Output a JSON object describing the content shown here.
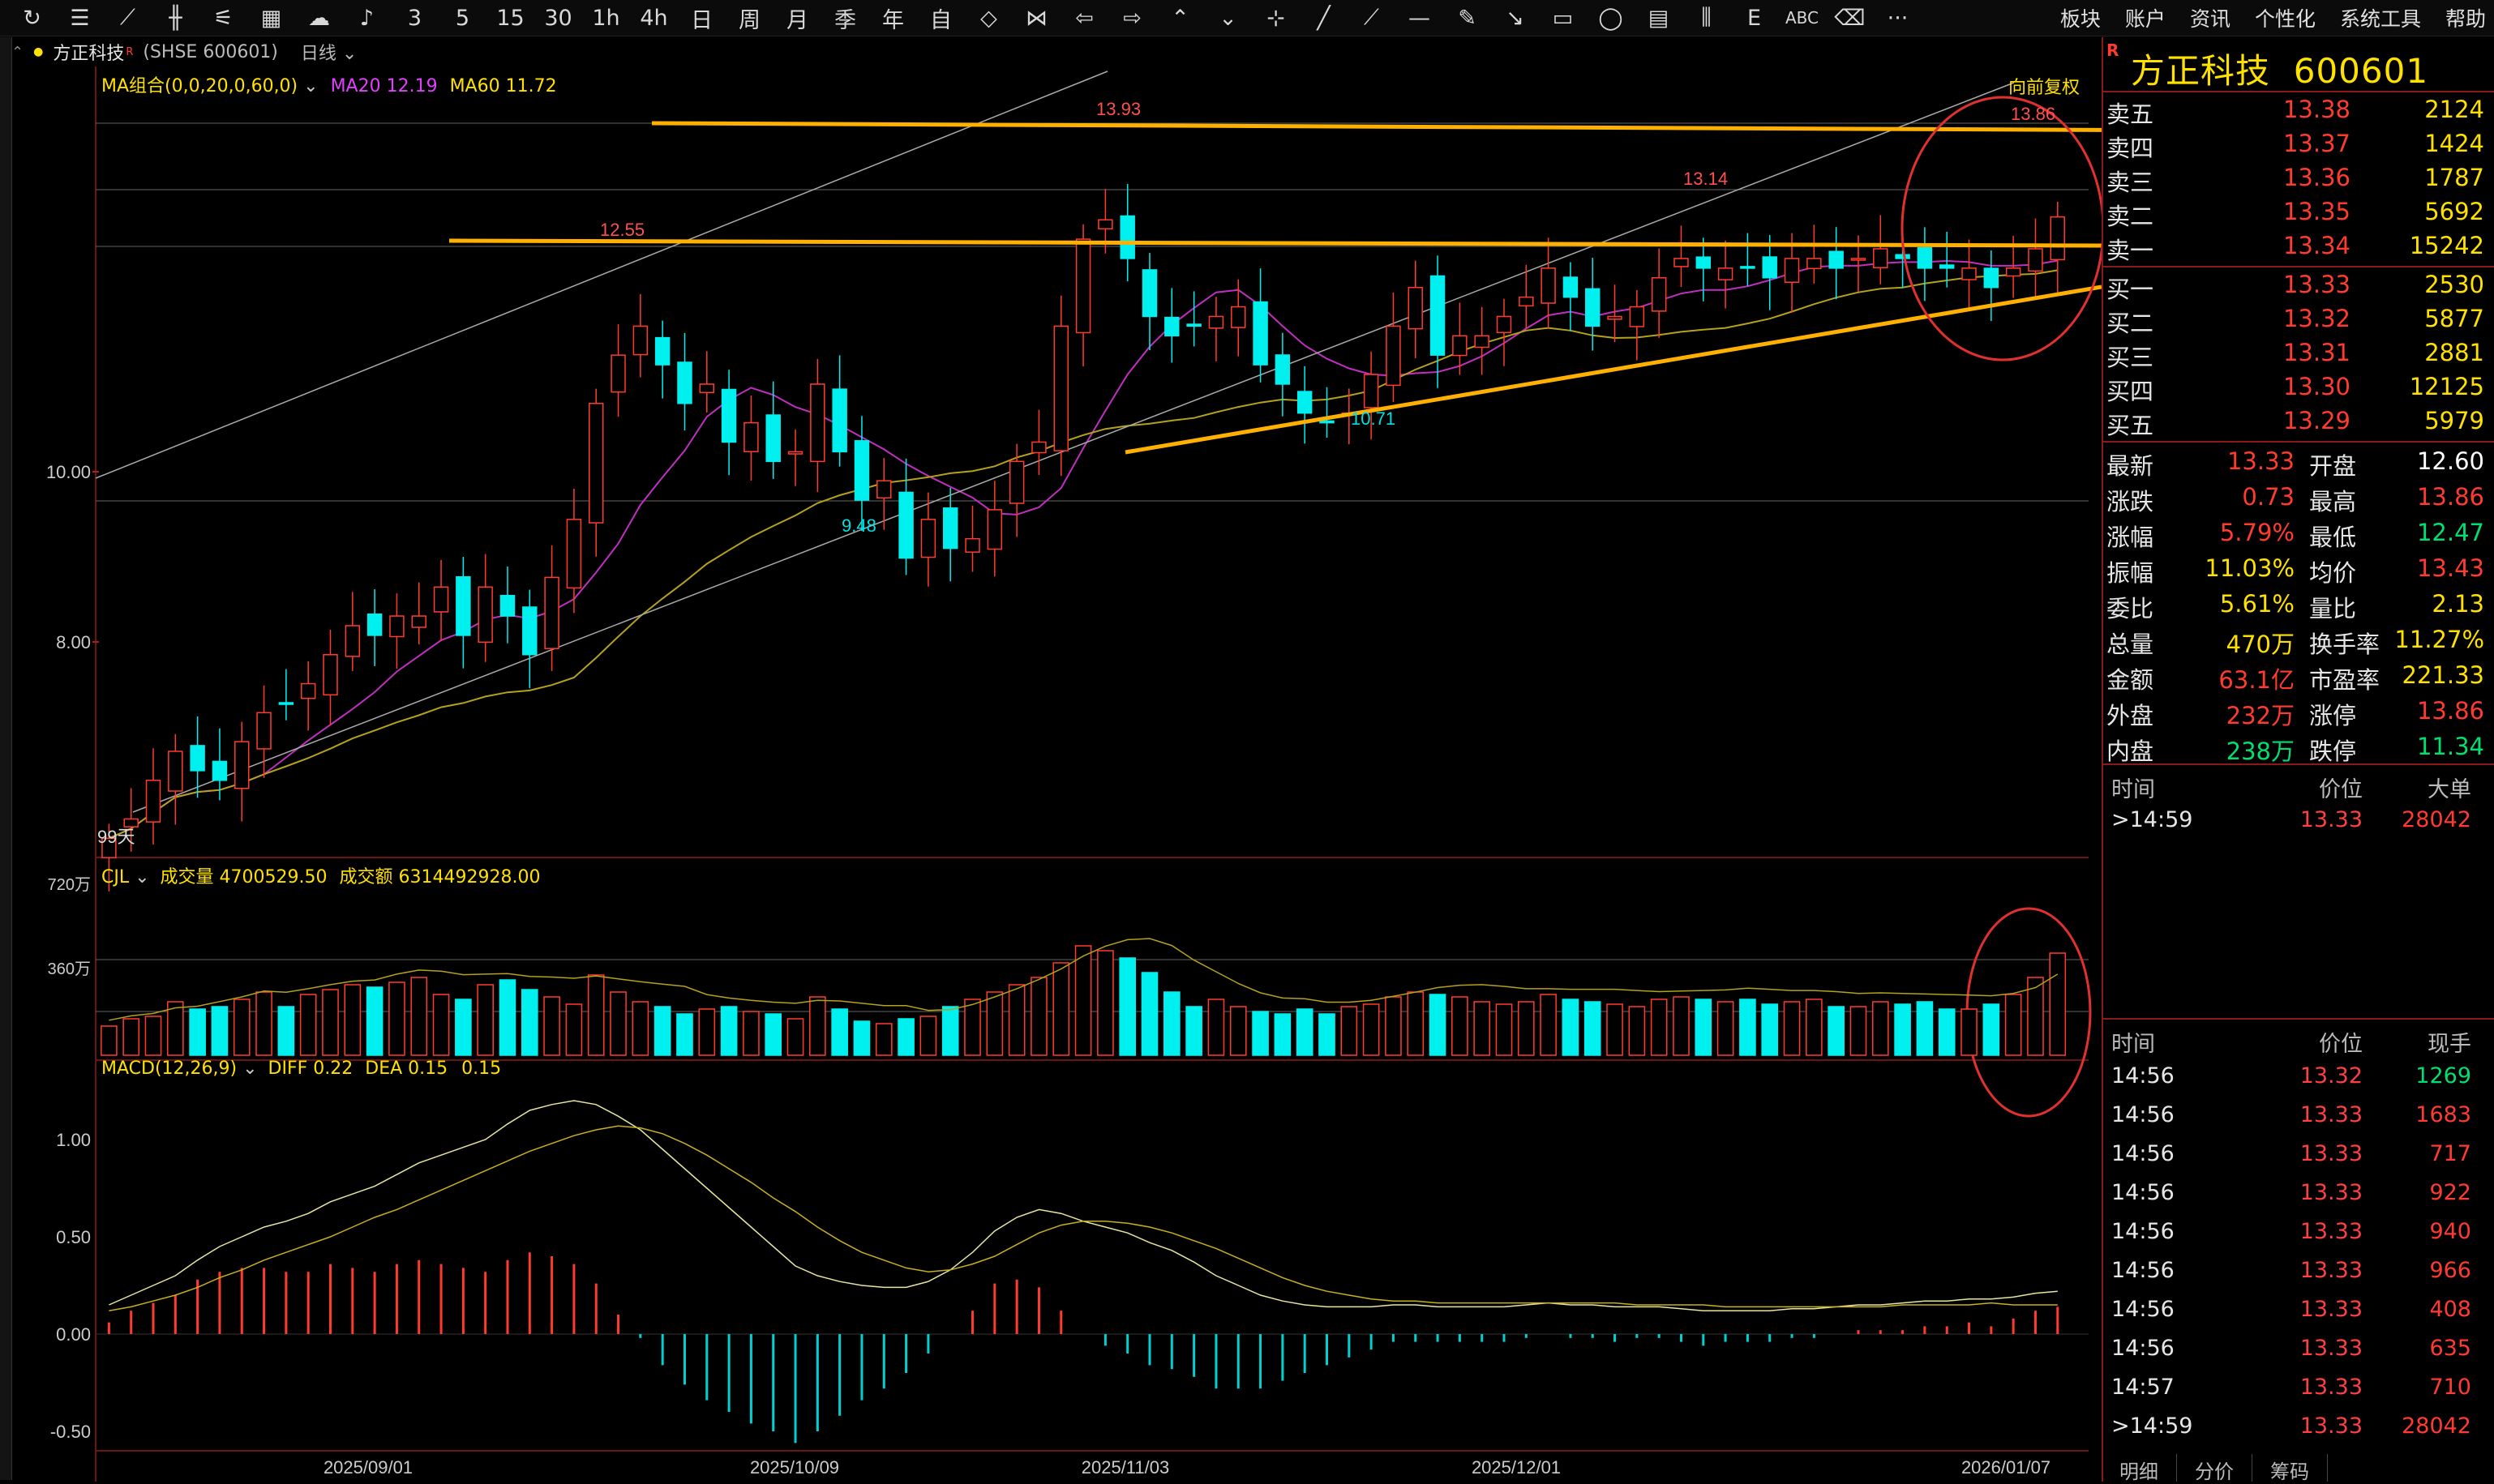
{
  "toolbar": {
    "icons": [
      "refresh-icon",
      "list-icon",
      "line-chart-icon",
      "candle-icon",
      "fib-icon",
      "calendar-icon",
      "cloud-icon",
      "bell-icon",
      "period-3-icon",
      "period-5-icon",
      "period-15-icon",
      "period-30-icon",
      "period-1h-icon",
      "period-4h-icon",
      "period-day-icon",
      "period-week-icon",
      "period-month-icon",
      "period-quarter-icon",
      "period-year-icon",
      "custom-icon",
      "zoom-fit-icon",
      "zoom-in-icon",
      "arrow-left-icon",
      "arrow-right-icon",
      "arrow-up-icon",
      "arrow-down-icon",
      "crosshair-icon",
      "line-tool-icon",
      "ray-icon",
      "hline-icon",
      "pencil-icon",
      "arrow-tool-icon",
      "rect-icon",
      "ellipse-icon",
      "channel-icon",
      "parallel-icon",
      "fib-tool-icon",
      "text-tool-icon",
      "eraser-icon",
      "more-icon"
    ],
    "period_labels": [
      "3",
      "5",
      "15",
      "30",
      "1h",
      "4h",
      "日",
      "周",
      "月",
      "季",
      "年",
      "自"
    ],
    "text_tool": "ABC",
    "more": "···",
    "menu": [
      "板块",
      "账户",
      "资讯",
      "个性化",
      "系统工具",
      "帮助"
    ]
  },
  "stockbar": {
    "name": "方正科技",
    "superscript": "R",
    "code": "(SHSE 600601)",
    "period": "日线"
  },
  "indicator_main": {
    "label": "MA组合(0,0,20,0,60,0)",
    "ma20_label": "MA20",
    "ma20": "12.19",
    "ma60_label": "MA60",
    "ma60": "11.72",
    "adjust": "向前复权"
  },
  "indicator_vol": {
    "label": "CJL",
    "vol_label": "成交量",
    "vol": "4700529.50",
    "amt_label": "成交额",
    "amt": "6314492928.00"
  },
  "indicator_macd": {
    "label": "MACD(12,26,9)",
    "diff_label": "DIFF",
    "diff": "0.22",
    "dea_label": "DEA",
    "dea": "0.15",
    "macd": "0.15"
  },
  "chart_data": {
    "type": "candlestick",
    "price_ticks": [
      "10.00",
      "8.00"
    ],
    "vol_ticks": [
      "720万",
      "360万"
    ],
    "macd_ticks": [
      "1.00",
      "0.50",
      "0.00",
      "-0.50"
    ],
    "dates": [
      "2025/09/01",
      "2025/10/09",
      "2025/11/03",
      "2025/12/01",
      "2026/01/07"
    ],
    "annotations": {
      "high_1": "13.93",
      "high_2": "12.55",
      "high_3": "13.14",
      "high_4": "13.86",
      "low_1": "9.48",
      "low_2": "10.71",
      "days": "99天"
    },
    "closes": [
      6.9,
      7.1,
      7.5,
      7.8,
      7.6,
      7.5,
      7.9,
      8.2,
      8.3,
      8.5,
      8.8,
      9.1,
      9.0,
      9.2,
      9.2,
      9.5,
      9.0,
      9.5,
      9.2,
      8.8,
      9.6,
      10.2,
      11.4,
      11.9,
      12.2,
      11.8,
      11.4,
      11.6,
      11.0,
      11.2,
      10.8,
      10.9,
      11.6,
      10.9,
      10.4,
      10.6,
      9.8,
      10.2,
      9.9,
      10.0,
      10.3,
      10.8,
      11.0,
      12.2,
      13.1,
      13.3,
      12.9,
      12.3,
      12.1,
      12.2,
      12.3,
      12.4,
      11.8,
      11.6,
      11.3,
      11.2,
      11.3,
      11.7,
      12.2,
      12.6,
      11.9,
      12.1,
      12.1,
      12.3,
      12.5,
      12.8,
      12.5,
      12.2,
      12.3,
      12.4,
      12.7,
      12.9,
      12.8,
      12.8,
      12.8,
      12.7,
      12.9,
      12.9,
      12.8,
      12.9,
      13.0,
      12.9,
      12.8,
      12.8,
      12.8,
      12.6,
      12.8,
      13.0,
      13.33
    ],
    "volumes_wan": [
      120,
      150,
      160,
      220,
      190,
      200,
      230,
      260,
      200,
      250,
      270,
      290,
      280,
      300,
      320,
      250,
      230,
      290,
      310,
      270,
      240,
      210,
      330,
      260,
      220,
      200,
      170,
      190,
      200,
      180,
      170,
      150,
      240,
      190,
      140,
      130,
      150,
      160,
      200,
      230,
      260,
      290,
      320,
      380,
      450,
      430,
      400,
      340,
      260,
      200,
      230,
      200,
      180,
      170,
      190,
      170,
      200,
      210,
      240,
      260,
      250,
      240,
      220,
      210,
      220,
      250,
      230,
      220,
      210,
      200,
      230,
      240,
      230,
      220,
      230,
      210,
      220,
      230,
      200,
      200,
      220,
      210,
      220,
      190,
      190,
      210,
      250,
      320,
      420
    ],
    "macd_diff": [
      0.15,
      0.2,
      0.25,
      0.3,
      0.38,
      0.45,
      0.5,
      0.55,
      0.58,
      0.62,
      0.68,
      0.72,
      0.76,
      0.82,
      0.88,
      0.92,
      0.96,
      1.0,
      1.08,
      1.15,
      1.18,
      1.2,
      1.18,
      1.12,
      1.05,
      0.95,
      0.85,
      0.75,
      0.65,
      0.55,
      0.45,
      0.35,
      0.3,
      0.27,
      0.25,
      0.24,
      0.24,
      0.27,
      0.33,
      0.42,
      0.53,
      0.6,
      0.64,
      0.62,
      0.58,
      0.55,
      0.52,
      0.47,
      0.43,
      0.37,
      0.3,
      0.25,
      0.2,
      0.17,
      0.15,
      0.14,
      0.14,
      0.14,
      0.15,
      0.15,
      0.14,
      0.14,
      0.14,
      0.14,
      0.15,
      0.16,
      0.15,
      0.15,
      0.14,
      0.14,
      0.14,
      0.13,
      0.12,
      0.12,
      0.12,
      0.12,
      0.13,
      0.13,
      0.14,
      0.15,
      0.15,
      0.16,
      0.17,
      0.17,
      0.18,
      0.18,
      0.19,
      0.21,
      0.22
    ],
    "macd_dea": [
      0.12,
      0.14,
      0.17,
      0.2,
      0.24,
      0.29,
      0.33,
      0.38,
      0.42,
      0.46,
      0.5,
      0.55,
      0.6,
      0.64,
      0.69,
      0.74,
      0.79,
      0.84,
      0.89,
      0.94,
      0.98,
      1.02,
      1.05,
      1.07,
      1.06,
      1.03,
      0.98,
      0.92,
      0.85,
      0.78,
      0.7,
      0.63,
      0.55,
      0.48,
      0.42,
      0.38,
      0.34,
      0.32,
      0.33,
      0.36,
      0.4,
      0.46,
      0.52,
      0.56,
      0.58,
      0.58,
      0.57,
      0.55,
      0.52,
      0.48,
      0.44,
      0.39,
      0.34,
      0.29,
      0.25,
      0.22,
      0.2,
      0.18,
      0.17,
      0.17,
      0.16,
      0.16,
      0.16,
      0.16,
      0.16,
      0.16,
      0.16,
      0.16,
      0.16,
      0.15,
      0.15,
      0.15,
      0.15,
      0.14,
      0.14,
      0.14,
      0.14,
      0.14,
      0.14,
      0.14,
      0.14,
      0.15,
      0.15,
      0.15,
      0.15,
      0.16,
      0.15,
      0.15,
      0.15
    ]
  },
  "quote": {
    "name": "方正科技",
    "code": "600601",
    "badge": "R",
    "asks": [
      {
        "label": "卖五",
        "price": "13.38",
        "vol": "2124"
      },
      {
        "label": "卖四",
        "price": "13.37",
        "vol": "1424"
      },
      {
        "label": "卖三",
        "price": "13.36",
        "vol": "1787"
      },
      {
        "label": "卖二",
        "price": "13.35",
        "vol": "5692"
      },
      {
        "label": "卖一",
        "price": "13.34",
        "vol": "15242"
      }
    ],
    "bids": [
      {
        "label": "买一",
        "price": "13.33",
        "vol": "2530"
      },
      {
        "label": "买二",
        "price": "13.32",
        "vol": "5877"
      },
      {
        "label": "买三",
        "price": "13.31",
        "vol": "2881"
      },
      {
        "label": "买四",
        "price": "13.30",
        "vol": "12125"
      },
      {
        "label": "买五",
        "price": "13.29",
        "vol": "5979"
      }
    ],
    "stats": [
      {
        "l1": "最新",
        "v1": "13.33",
        "l2": "开盘",
        "v2": "12.60"
      },
      {
        "l1": "涨跌",
        "v1": "0.73",
        "l2": "最高",
        "v2": "13.86"
      },
      {
        "l1": "涨幅",
        "v1": "5.79%",
        "l2": "最低",
        "v2": "12.47"
      },
      {
        "l1": "振幅",
        "v1": "11.03%",
        "l2": "均价",
        "v2": "13.43"
      },
      {
        "l1": "委比",
        "v1": "5.61%",
        "l2": "量比",
        "v2": "2.13"
      },
      {
        "l1": "总量",
        "v1": "470万",
        "l2": "换手率",
        "v2": "11.27%"
      },
      {
        "l1": "金额",
        "v1": "63.1亿",
        "l2": "市盈率",
        "v2": "221.33"
      },
      {
        "l1": "外盘",
        "v1": "232万",
        "l2": "涨停",
        "v2": "13.86"
      },
      {
        "l1": "内盘",
        "v1": "238万",
        "l2": "跌停",
        "v2": "11.34"
      }
    ],
    "big_head": {
      "time": "时间",
      "price": "价位",
      "vol": "大单"
    },
    "big": [
      {
        "time": ">14:59",
        "price": "13.33",
        "vol": "28042"
      }
    ],
    "tick_head": {
      "time": "时间",
      "price": "价位",
      "vol": "现手"
    },
    "ticks": [
      {
        "time": "14:56",
        "price": "13.32",
        "vol": "1269"
      },
      {
        "time": "14:56",
        "price": "13.33",
        "vol": "1683"
      },
      {
        "time": "14:56",
        "price": "13.33",
        "vol": "717"
      },
      {
        "time": "14:56",
        "price": "13.33",
        "vol": "922"
      },
      {
        "time": "14:56",
        "price": "13.33",
        "vol": "940"
      },
      {
        "time": "14:56",
        "price": "13.33",
        "vol": "966"
      },
      {
        "time": "14:56",
        "price": "13.33",
        "vol": "408"
      },
      {
        "time": "14:56",
        "price": "13.33",
        "vol": "635"
      },
      {
        "time": "14:57",
        "price": "13.33",
        "vol": "710"
      },
      {
        "time": ">14:59",
        "price": "13.33",
        "vol": "28042"
      }
    ],
    "tabs": [
      "明细",
      "分价",
      "筹码"
    ]
  }
}
